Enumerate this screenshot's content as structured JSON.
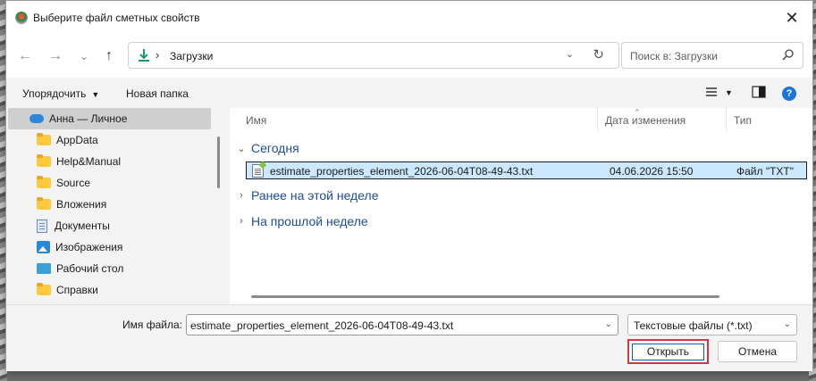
{
  "window": {
    "title": "Выберите файл сметных свойств",
    "close_glyph": "✕",
    "icon": "app-logo-icon"
  },
  "nav": {
    "back_glyph": "←",
    "forward_glyph": "→",
    "recent_glyph": "⌄",
    "up_glyph": "↑",
    "address": {
      "separator": "›",
      "location": "Загрузки",
      "chevron": "⌄",
      "refresh_glyph": "↻"
    },
    "search": {
      "placeholder": "Поиск в: Загрузки"
    }
  },
  "toolbar": {
    "organize_label": "Упорядочить",
    "organize_arrow": "▼",
    "new_folder_label": "Новая папка",
    "view_arrow": "▼",
    "help_glyph": "?"
  },
  "sidebar": {
    "items": [
      {
        "label": "Анна — Личное",
        "icon": "cloud-icon",
        "selected": true
      },
      {
        "label": "AppData",
        "icon": "folder-icon"
      },
      {
        "label": "Help&Manual",
        "icon": "folder-icon"
      },
      {
        "label": "Source",
        "icon": "folder-icon"
      },
      {
        "label": "Вложения",
        "icon": "folder-icon"
      },
      {
        "label": "Документы",
        "icon": "documents-icon"
      },
      {
        "label": "Изображения",
        "icon": "pictures-icon"
      },
      {
        "label": "Рабочий стол",
        "icon": "desktop-icon"
      },
      {
        "label": "Справки",
        "icon": "folder-icon"
      }
    ]
  },
  "filelist": {
    "columns": [
      "Имя",
      "Дата изменения",
      "Тип"
    ],
    "sort_glyph": "^",
    "groups": [
      {
        "label": "Сегодня",
        "expanded": true,
        "chevron": "⌄"
      },
      {
        "label": "Ранее на этой неделе",
        "expanded": false,
        "chevron": "›"
      },
      {
        "label": "На прошлой неделе",
        "expanded": false,
        "chevron": "›"
      }
    ],
    "files": [
      {
        "name": "estimate_properties_element_2026-06-04T08-49-43.txt",
        "date": "04.06.2026 15:50",
        "type": "Файл \"TXT\"",
        "selected": true
      }
    ]
  },
  "bottom": {
    "filename_label": "Имя файла:",
    "filename_value": "estimate_properties_element_2026-06-04T08-49-43.txt",
    "filename_chevron": "⌄",
    "filter_value": "Текстовые файлы (*.txt)",
    "filter_chevron": "⌄",
    "open_label": "Открыть",
    "cancel_label": "Отмена"
  },
  "colors": {
    "accent": "#005fb8",
    "highlight": "#d9334a",
    "selection": "#cce8ff",
    "group_text": "#1f4e96"
  }
}
